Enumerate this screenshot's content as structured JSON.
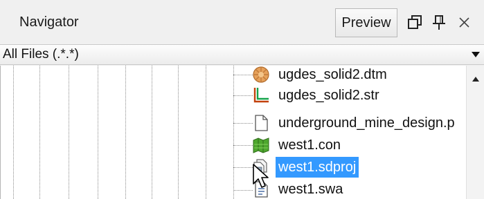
{
  "navigator": {
    "title": "Navigator",
    "preview_label": "Preview",
    "icons": [
      "float-window-icon",
      "pin-icon",
      "close-icon"
    ]
  },
  "filter": {
    "value": "All Files (.*.*)"
  },
  "files": [
    {
      "name": "ugdes_solid2.dtm",
      "icon": "dtm-file-icon",
      "selected": false
    },
    {
      "name": "ugdes_solid2.str",
      "icon": "str-file-icon",
      "selected": false
    },
    {
      "name": "underground_mine_design.p",
      "icon": "document-file-icon",
      "selected": false
    },
    {
      "name": "west1.con",
      "icon": "con-file-icon",
      "selected": false
    },
    {
      "name": "west1.sdproj",
      "icon": "sdproj-file-icon",
      "selected": true
    },
    {
      "name": "west1.swa",
      "icon": "swa-file-icon",
      "selected": false
    }
  ],
  "colors": {
    "selection": "#3399ff",
    "panel_bg": "#f0f0f0"
  }
}
